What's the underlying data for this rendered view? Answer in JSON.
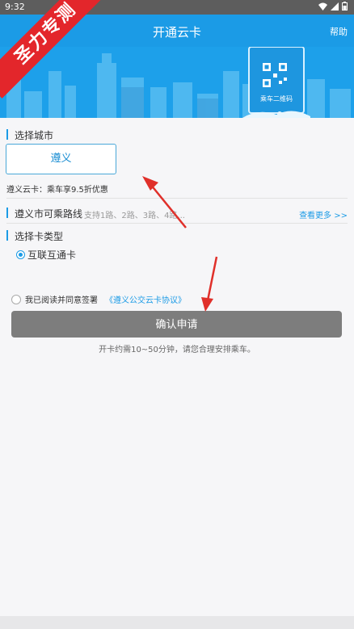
{
  "status_bar": {
    "time": "9:32",
    "icons": [
      "wifi-icon",
      "signal-icon",
      "battery-icon"
    ]
  },
  "watermark": "圣力专测",
  "header": {
    "title": "开通云卡",
    "help": "帮助"
  },
  "banner": {
    "qr_label": "乘车二维码"
  },
  "city_section": {
    "title": "选择城市",
    "selected_city": "遵义",
    "note": "遵义云卡：乘车享9.5折优惠"
  },
  "routes_section": {
    "title": "遵义市可乘路线",
    "routes_preview": "支持1路、2路、3路、4路...",
    "see_more": "查看更多 >>"
  },
  "card_type_section": {
    "title": "选择卡类型",
    "options": [
      {
        "label": "互联互通卡",
        "selected": true
      }
    ]
  },
  "agreement": {
    "text": "我已阅读并同意签署",
    "link": "《遵义公交云卡协议》",
    "checked": false
  },
  "confirm_button": "确认申请",
  "tip": "开卡约需10~50分钟，请您合理安排乘车。",
  "colors": {
    "brand": "#1b9be6",
    "button_disabled": "#7d7d7d",
    "watermark": "#e3262b",
    "arrow": "#e0302a"
  }
}
